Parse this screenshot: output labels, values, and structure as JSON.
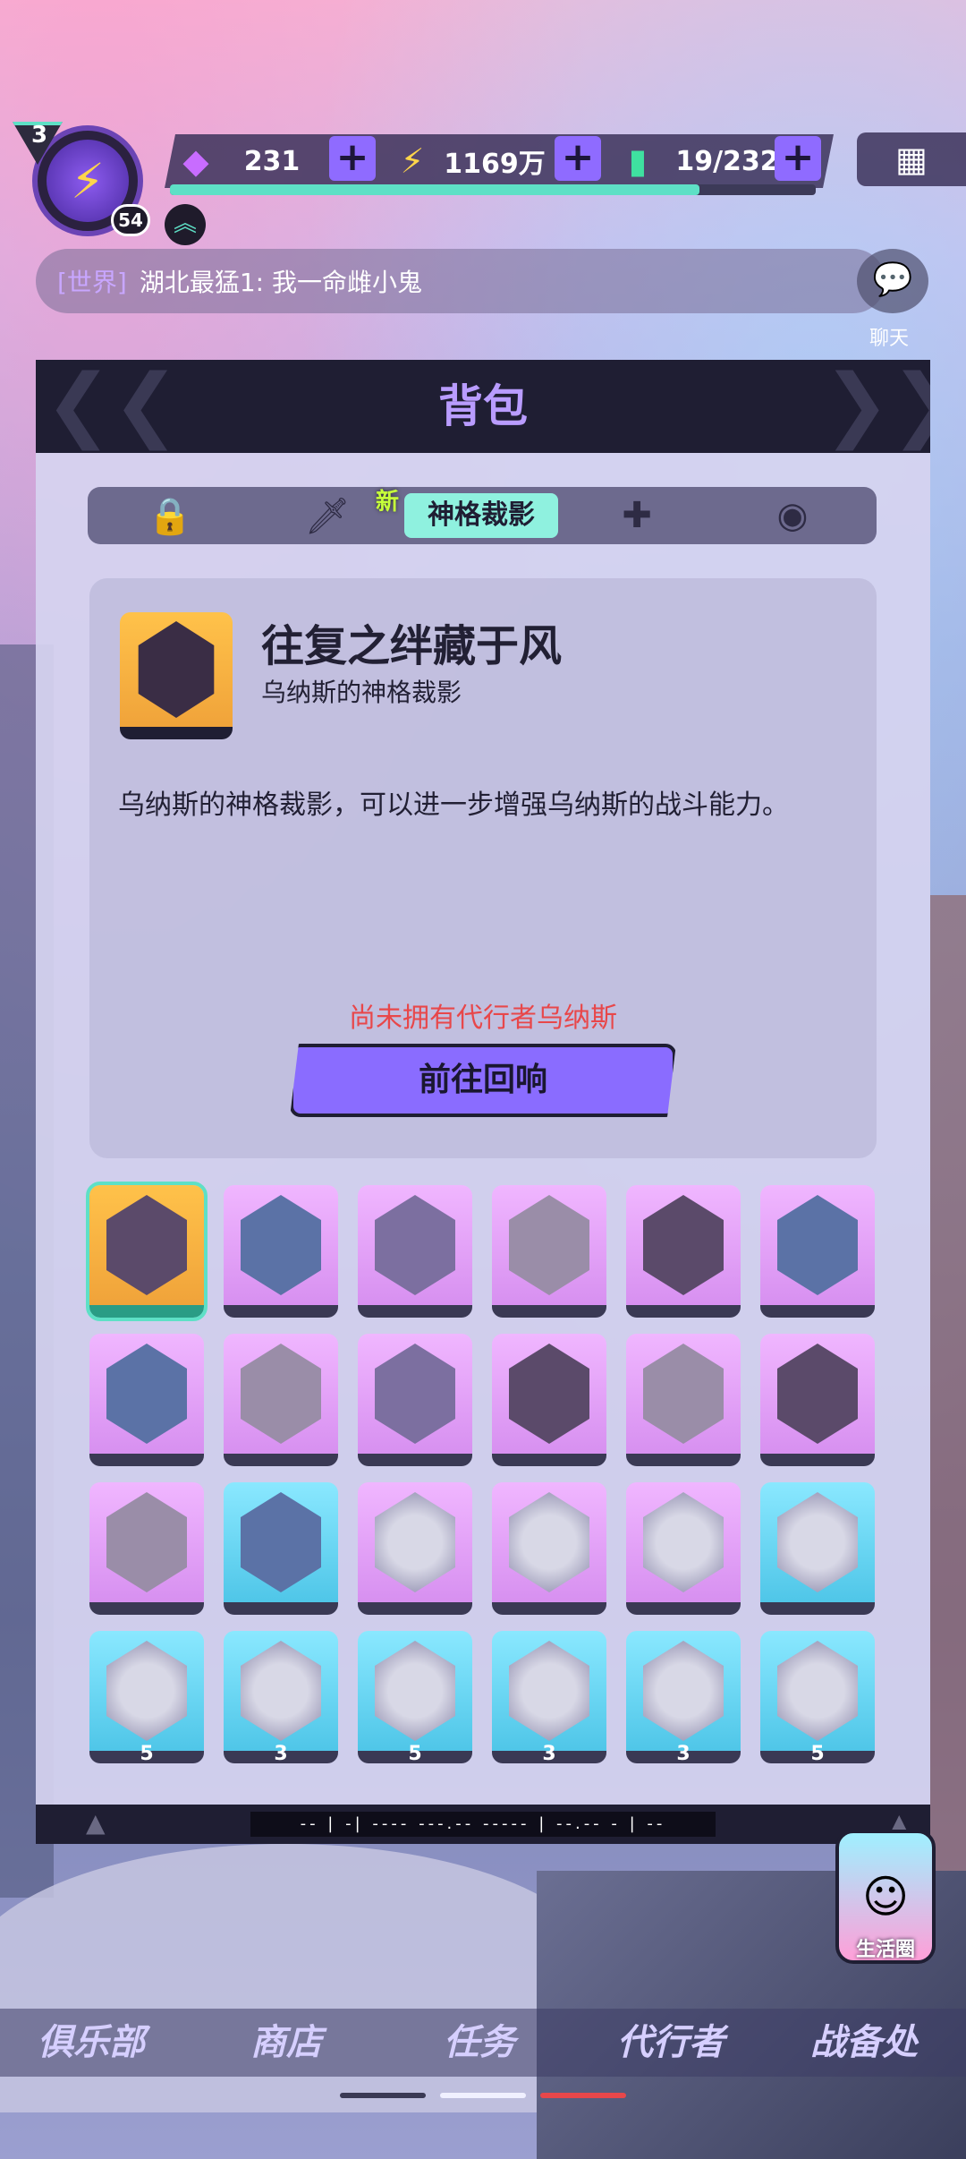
{
  "player": {
    "level": "3",
    "sub_level": "54"
  },
  "resources": [
    {
      "name": "crystal-icon",
      "value": "231"
    },
    {
      "name": "coin-icon",
      "value": "1169万"
    },
    {
      "name": "energy-icon",
      "value": "19/232"
    }
  ],
  "xp_progress": 0.82,
  "chat": {
    "channel": "[世界]",
    "message": "湖北最猛1: 我一命雌小鬼",
    "button_label": "聊天"
  },
  "panel": {
    "title": "背包"
  },
  "tabs": [
    {
      "icon": "bag-icon"
    },
    {
      "icon": "sword-icon"
    },
    {
      "label": "神格裁影",
      "badge": "新",
      "active": true
    },
    {
      "icon": "puzzle-icon"
    },
    {
      "icon": "mask-icon"
    }
  ],
  "detail": {
    "name": "往复之绊藏于风",
    "subtitle": "乌纳斯的神格裁影",
    "description": "乌纳斯的神格裁影，可以进一步增强乌纳斯的战斗能力。",
    "warning": "尚未拥有代行者乌纳斯",
    "action_label": "前往回响"
  },
  "items_row4_counts": [
    "5",
    "3",
    "5",
    "3",
    "3",
    "5"
  ],
  "bottom_ticker": "-- | -| ---- ---.-- ----- | --.-- -  | --",
  "life_circle": {
    "label": "生活圈"
  },
  "nav": [
    {
      "label": "俱乐部"
    },
    {
      "label": "商店"
    },
    {
      "label": "任务"
    },
    {
      "label": "代行者"
    },
    {
      "label": "战备处"
    }
  ]
}
